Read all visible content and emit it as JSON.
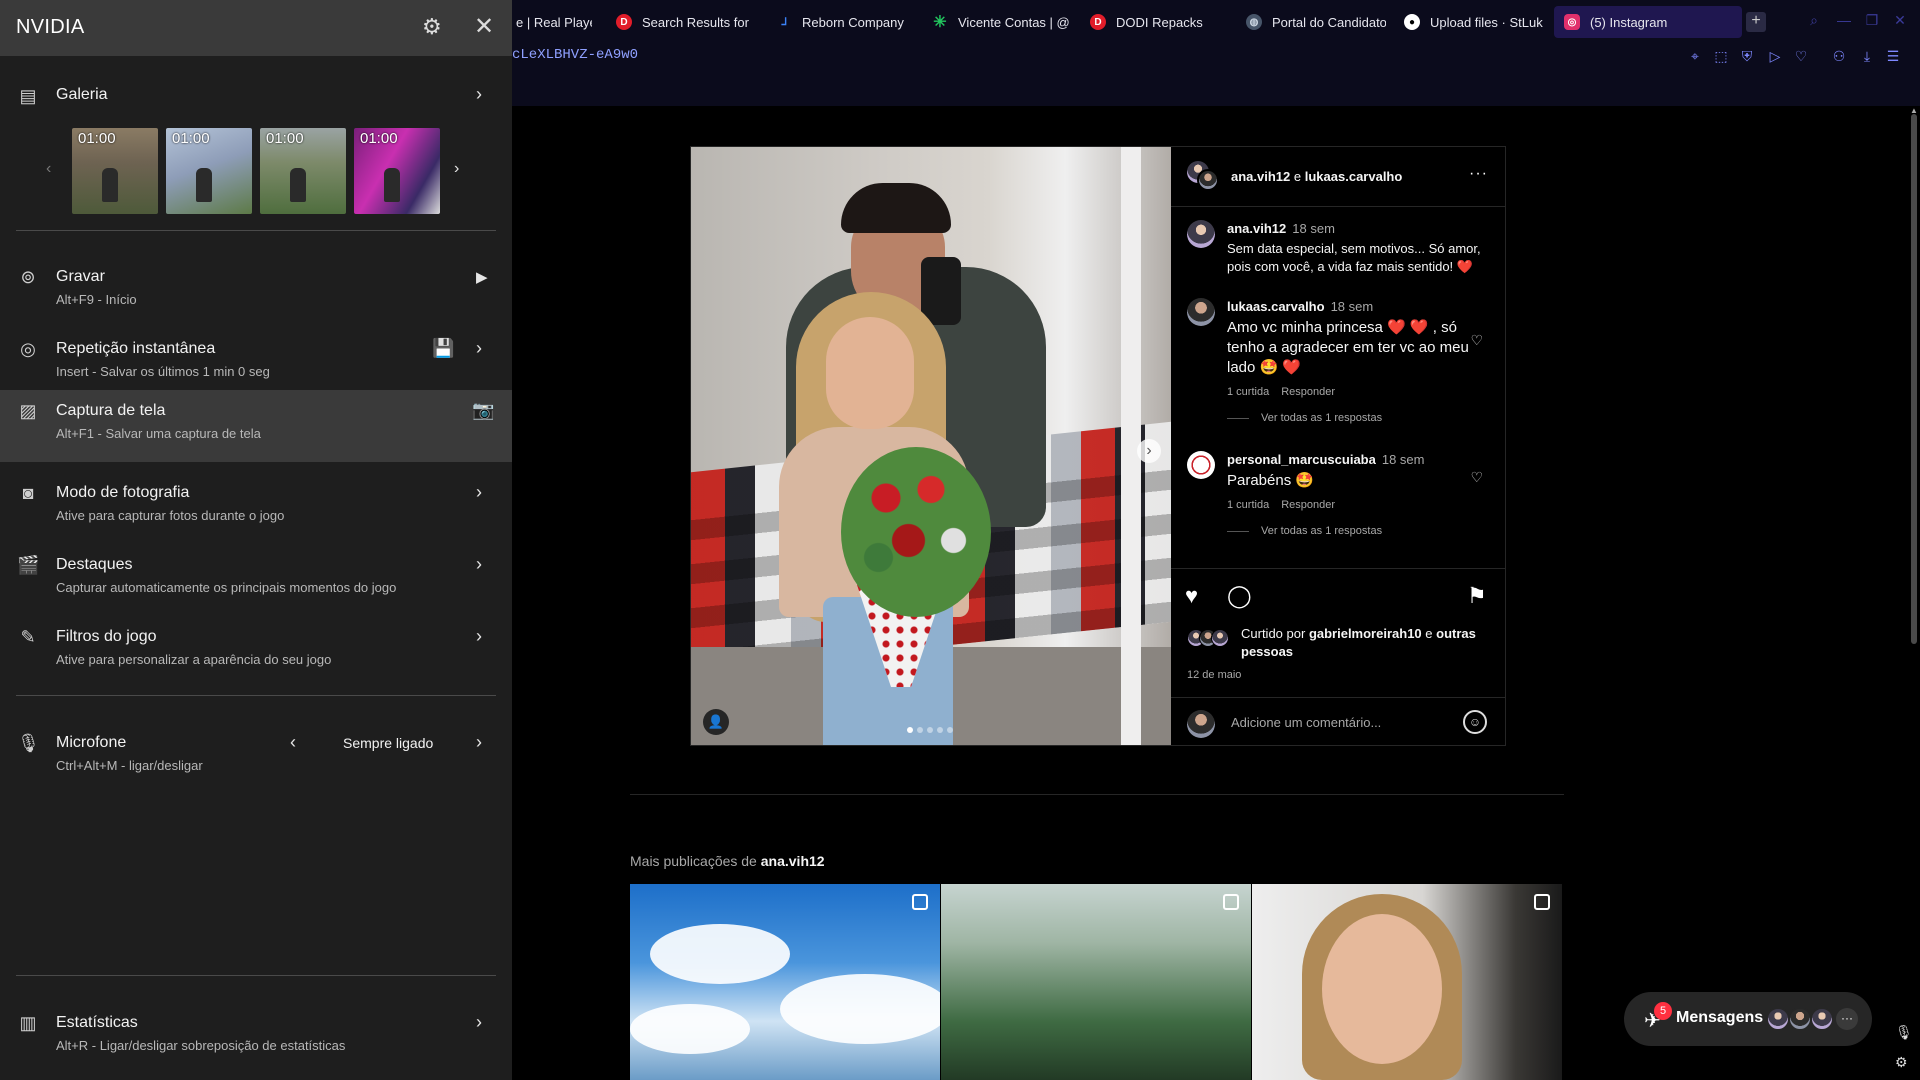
{
  "browser": {
    "tabs": [
      {
        "label": "e | Real Player",
        "icon": "rp-icon",
        "color": "#1d4fd8"
      },
      {
        "label": "Search Results for",
        "icon": "dodi-icon",
        "color": "#e11d2a"
      },
      {
        "label": "Reborn Company",
        "icon": "reborn-icon",
        "color": "#3b82f6"
      },
      {
        "label": "Vicente Contas | @",
        "icon": "asterisk-icon",
        "color": "#22c55e"
      },
      {
        "label": "DODI Repacks",
        "icon": "dodi-icon",
        "color": "#e11d2a"
      },
      {
        "label": "Portal do Candidato",
        "icon": "globe-icon",
        "color": "#64748b"
      },
      {
        "label": "Upload files · StLuk",
        "icon": "github-icon",
        "color": "#ffffff"
      },
      {
        "label": "(5) Instagram",
        "icon": "instagram-icon",
        "color": "#e1306c"
      }
    ],
    "url": "cLeXLBHVZ-eA9w0"
  },
  "instagram": {
    "post": {
      "user1": "ana.vih12",
      "conj": "e",
      "user2": "lukaas.carvalho",
      "more": "···",
      "comments": [
        {
          "user": "ana.vih12",
          "time": "18 sem",
          "text": "Sem data especial, sem motivos... Só amor, pois com você, a vida faz mais sentido! ❤️"
        },
        {
          "user": "lukaas.carvalho",
          "time": "18 sem",
          "text": "Amo vc minha princesa ❤️ ❤️ , só tenho a agradecer em ter vc ao meu lado 🤩 ❤️",
          "likes": "1 curtida",
          "reply": "Responder",
          "view_all": "Ver todas as 1 respostas"
        },
        {
          "user": "personal_marcuscuiaba",
          "time": "18 sem",
          "text": "Parabéns 🤩",
          "likes": "1 curtida",
          "reply": "Responder",
          "view_all": "Ver todas as 1 respostas"
        }
      ],
      "liked_prefix": "Curtido por",
      "liked_user": "gabrielmoreirah10",
      "liked_and": "e",
      "liked_others": "outras pessoas",
      "date": "12 de maio",
      "add_comment_placeholder": "Adicione um comentário...",
      "photo_count": 5,
      "photo_current": 1
    },
    "more_from_label": "Mais publicações de",
    "more_from_user": "ana.vih12",
    "messages": {
      "label": "Mensagens",
      "badge": "5"
    }
  },
  "nvidia": {
    "title": "NVIDIA",
    "gallery": {
      "label": "Galeria",
      "thumbs": [
        "01:00",
        "01:00",
        "01:00",
        "01:00"
      ]
    },
    "items": [
      {
        "label": "Gravar",
        "sub": "Alt+F9 - Início"
      },
      {
        "label": "Repetição instantânea",
        "sub": "Insert - Salvar os últimos 1 min 0 seg"
      },
      {
        "label": "Captura de tela",
        "sub": "Alt+F1 - Salvar uma captura de tela"
      },
      {
        "label": "Modo de fotografia",
        "sub": "Ative para capturar fotos durante o jogo"
      },
      {
        "label": "Destaques",
        "sub": "Capturar automaticamente os principais momentos do jogo"
      },
      {
        "label": "Filtros do jogo",
        "sub": "Ative para personalizar a aparência do seu jogo"
      }
    ],
    "microphone": {
      "label": "Microfone",
      "sub": "Ctrl+Alt+M - ligar/desligar",
      "value": "Sempre ligado"
    },
    "stats": {
      "label": "Estatísticas",
      "sub": "Alt+R - Ligar/desligar sobreposição de estatísticas"
    }
  }
}
